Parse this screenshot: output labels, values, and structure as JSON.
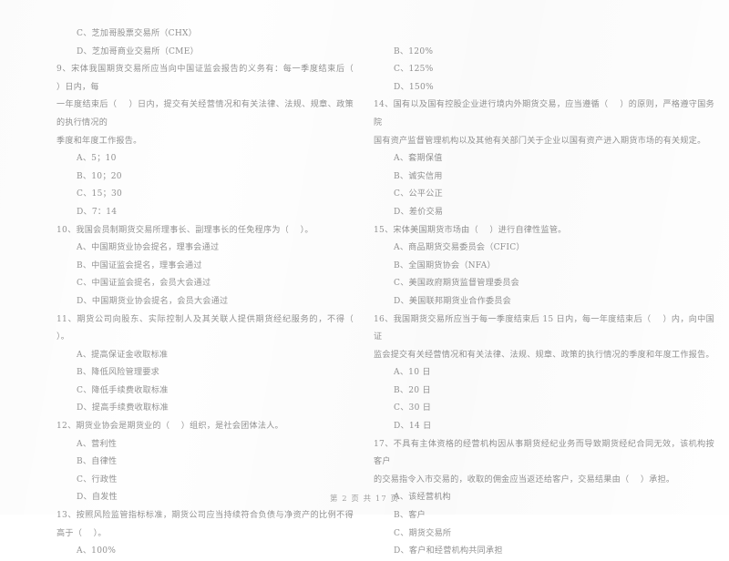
{
  "document": {
    "page_footer": "第 2 页 共 17 页",
    "page_number": "2",
    "total_pages": "17",
    "text_color": "#8a8a8a",
    "background_color": "#fefefe"
  },
  "left_column": {
    "orphan_options": [
      "C、芝加哥股票交易所（CHX）",
      "D、芝加哥商业交易所（CME）"
    ],
    "questions": [
      {
        "number": "9",
        "stem_lines": [
          "9、宋体我国期货交易所应当向中国证监会报告的义务有：每一季度结束后（    ）日内，每",
          "一年度结束后（    ）日内，提交有关经营情况和有关法律、法规、规章、政策的执行情况的",
          "季度和年度工作报告。"
        ],
        "options": [
          "A、5；10",
          "B、10；20",
          "C、15；30",
          "D、7：14"
        ]
      },
      {
        "number": "10",
        "stem_lines": [
          "10、我国会员制期货交易所理事长、副理事长的任免程序为（    ）。"
        ],
        "options": [
          "A、中国期货业协会提名，理事会通过",
          "B、中国证监会提名，理事会通过",
          "C、中国证监会提名，会员大会通过",
          "D、中国期货业协会提名，会员大会通过"
        ]
      },
      {
        "number": "11",
        "stem_lines": [
          "11、期货公司向股东、实际控制人及其关联人提供期货经纪服务的，不得（    ）。"
        ],
        "options": [
          "A、提高保证金收取标准",
          "B、降低风险管理要求",
          "C、降低手续费收取标准",
          "D、提高手续费收取标准"
        ]
      },
      {
        "number": "12",
        "stem_lines": [
          "12、期货业协会是期货业的（    ）组织，是社会团体法人。"
        ],
        "options": [
          "A、营利性",
          "B、自律性",
          "C、行政性",
          "D、自发性"
        ]
      },
      {
        "number": "13",
        "stem_lines": [
          "13、按照风险监管指标标准，期货公司应当持续符合负债与净资产的比例不得高于（    ）。"
        ],
        "options": [
          "A、100%"
        ]
      }
    ]
  },
  "right_column": {
    "orphan_options": [
      "B、120%",
      "C、125%",
      "D、150%"
    ],
    "questions": [
      {
        "number": "14",
        "stem_lines": [
          "14、国有以及国有控股企业进行境内外期货交易，应当遵循（    ）的原则，严格遵守国务院",
          "国有资产监督管理机构以及其他有关部门关于企业以国有资产进入期货市场的有关规定。"
        ],
        "options": [
          "A、套期保值",
          "B、诚实信用",
          "C、公平公正",
          "D、差价交易"
        ]
      },
      {
        "number": "15",
        "stem_lines": [
          "15、宋体美国期货市场由（    ）进行自律性监管。"
        ],
        "options": [
          "A、商品期货交易委员会（CFIC）",
          "B、全国期货协会（NFA）",
          "C、美国政府期货监督管理委员会",
          "D、美国联邦期货业合作委员会"
        ]
      },
      {
        "number": "16",
        "stem_lines": [
          "16、我国期货交易所应当于每一季度结束后 15 日内，每一年度结束后（    ）内，向中国证",
          "监会提交有关经营情况和有关法律、法规、规章、政策的执行情况的季度和年度工作报告。"
        ],
        "options": [
          "A、10 日",
          "B、20 日",
          "C、30 日",
          "D、14 日"
        ]
      },
      {
        "number": "17",
        "stem_lines": [
          "17、不具有主体资格的经营机构因从事期货经纪业务而导致期货经纪合同无效，该机构按客户",
          "的交易指令入市交易的，收取的佣金应当返还给客户，交易结果由（    ）承担。"
        ],
        "options": [
          "A、该经营机构",
          "B、客户",
          "C、期货交易所",
          "D、客户和经营机构共同承担"
        ]
      }
    ]
  }
}
